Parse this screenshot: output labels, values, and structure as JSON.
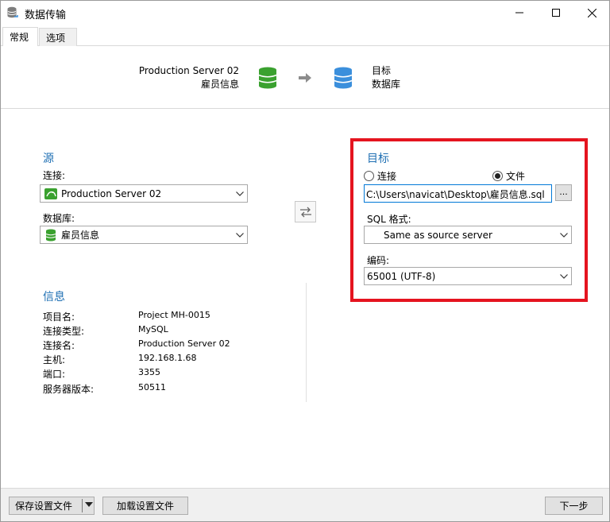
{
  "window": {
    "title": "数据传输"
  },
  "tabs": [
    {
      "label": "常规",
      "active": true
    },
    {
      "label": "选项",
      "active": false
    }
  ],
  "flow": {
    "source_server": "Production Server 02",
    "source_db": "雇员信息",
    "target_line1": "目标",
    "target_line2": "数据库"
  },
  "source": {
    "heading": "源",
    "connection_label": "连接:",
    "connection_value": "Production Server 02",
    "database_label": "数据库:",
    "database_value": "雇员信息"
  },
  "target": {
    "heading": "目标",
    "radio_connection": "连接",
    "radio_file": "文件",
    "selected": "文件",
    "file_path": "C:\\Users\\navicat\\Desktop\\雇员信息.sql",
    "browse_label": "...",
    "sql_format_label": "SQL 格式:",
    "sql_format_value": "Same as source server",
    "encoding_label": "编码:",
    "encoding_value": "65001 (UTF-8)"
  },
  "info": {
    "heading": "信息",
    "rows": [
      {
        "key": "项目名:",
        "value": "Project MH-0015"
      },
      {
        "key": "连接类型:",
        "value": "MySQL"
      },
      {
        "key": "连接名:",
        "value": "Production Server 02"
      },
      {
        "key": "主机:",
        "value": "192.168.1.68"
      },
      {
        "key": "端口:",
        "value": "3355"
      },
      {
        "key": "服务器版本:",
        "value": "50511"
      }
    ]
  },
  "footer": {
    "save_settings": "保存设置文件",
    "load_settings": "加载设置文件",
    "next": "下一步"
  },
  "colors": {
    "accent_heading": "#1e6fb3",
    "highlight_box": "#e5141f",
    "db_green": "#3aa12f",
    "db_blue": "#3b8fdc"
  }
}
